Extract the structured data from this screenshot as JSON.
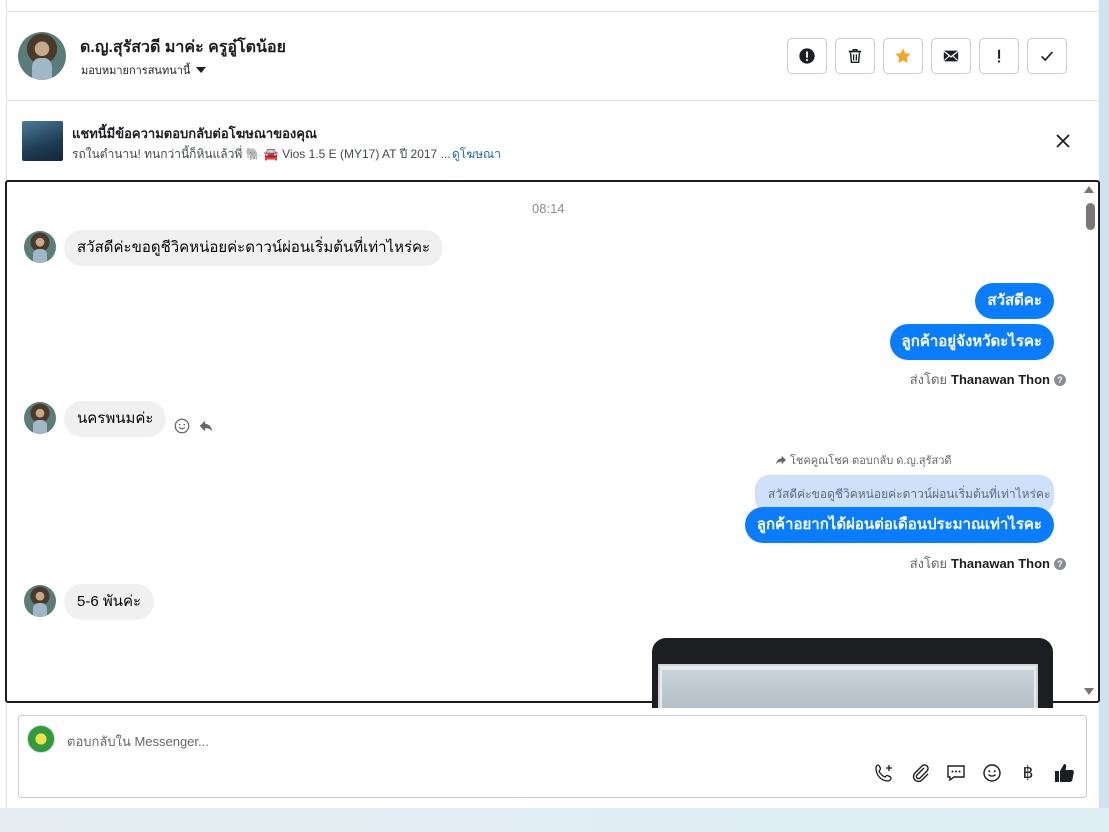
{
  "contact": {
    "name": "ด.ญ.สุรัสวดี มาค่ะ ครูอู๋โตน้อย",
    "assign_label": "มอบหมายการสนทนานี้"
  },
  "toolbar": {
    "icons": [
      "alert-circle-icon",
      "trash-icon",
      "star-icon",
      "mail-icon",
      "exclamation-icon",
      "check-icon"
    ],
    "star_color": "#f5a623"
  },
  "ad_banner": {
    "title": "แชทนี้มีข้อความตอบกลับต่อโฆษณาของคุณ",
    "subtitle": "รถในตำนาน! ทนกว่านี้ก็หินแล้วพี่ 🐘 🚘 Vios 1.5 E (MY17) AT ปี 2017 ...",
    "link": "ดูโฆษณา"
  },
  "thread": {
    "timestamp": "08:14",
    "messages": [
      {
        "dir": "in",
        "text": "สวัสดีค่ะขอดูชีวิคหน่อยค่ะดาวน์ผ่อนเริ่มต้นที่เท่าไหร่คะ"
      },
      {
        "dir": "out",
        "text": "สวัสดีคะ"
      },
      {
        "dir": "out",
        "text": "ลูกค้าอยู่จังหวัดะไรคะ"
      },
      {
        "dir": "in",
        "text": "นครพนมค่ะ"
      },
      {
        "dir": "out",
        "text": "ลูกค้าอยากได้ผ่อนต่อเดือนประมาณเท่าไรคะ"
      },
      {
        "dir": "in",
        "text": "5-6 พันค่ะ"
      }
    ],
    "sent_by_prefix": "ส่งโดย",
    "sent_by_name": "Thanawan Thon",
    "reply_meta": "โชคคูณโชค ตอบกลับ ด.ญ.สุรัสวดี",
    "quoted_text": "สวัสดีค่ะขอดูชีวิคหน่อยค่ะดาวน์ผ่อนเริ่มต้นที่เท่าไหร่คะ",
    "bubble_out_color": "#0a7cff"
  },
  "composer": {
    "placeholder": "ตอบกลับใน Messenger...",
    "currency_symbol": "฿",
    "tool_icons": [
      "phone-plus-icon",
      "paperclip-icon",
      "chat-bubble-icon",
      "emoji-icon",
      "baht-icon",
      "thumbs-up-icon"
    ]
  }
}
